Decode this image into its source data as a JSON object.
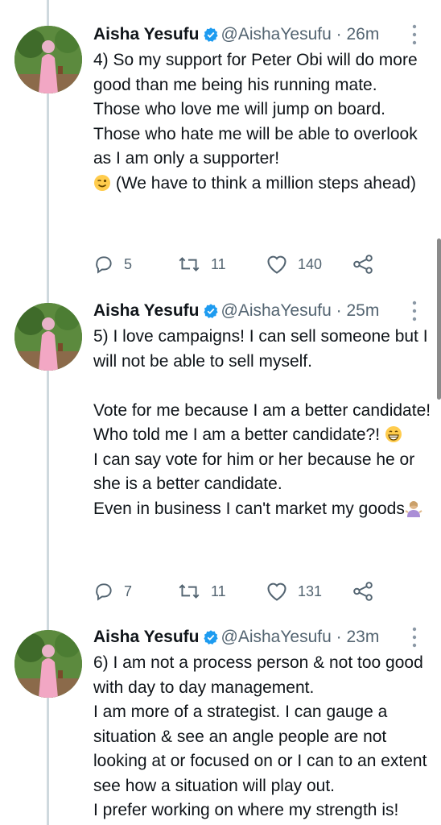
{
  "tweets": [
    {
      "name": "Aisha Yesufu",
      "handle": "@AishaYesufu",
      "sep": "·",
      "time": "26m",
      "text_before": "4) So my support for Peter Obi will do more good than me being his running mate.\nThose who love me will jump on board. Those who hate me will be able to overlook as I am only a supporter!\n",
      "emoji": "wink-emoji",
      "text_after": " (We have to think a million steps ahead)",
      "replies": "5",
      "retweets": "11",
      "likes": "140"
    },
    {
      "name": "Aisha Yesufu",
      "handle": "@AishaYesufu",
      "sep": "·",
      "time": "25m",
      "text_before": "5) I love campaigns! I can sell someone but I will not be able to sell myself.\n\nVote for me because I am a better candidate! Who told me I am a better candidate?! ",
      "emoji": "grin-emoji",
      "text_mid": "\nI can say vote for him or her because he or she is a better candidate.\nEven in business I can't market my goods",
      "emoji2": "shrug-emoji",
      "replies": "7",
      "retweets": "11",
      "likes": "131"
    },
    {
      "name": "Aisha Yesufu",
      "handle": "@AishaYesufu",
      "sep": "·",
      "time": "23m",
      "text_before": "6) I am not a process person & not too good with day to day management.\nI am more of a strategist. I can gauge a situation & see an angle people are not looking at or focused on or I can to an extent see how a situation will play out.\nI prefer working on where my strength is!"
    }
  ],
  "colors": {
    "accent": "#1d9bf0",
    "muted": "#536471",
    "thread": "#cfd9de"
  }
}
